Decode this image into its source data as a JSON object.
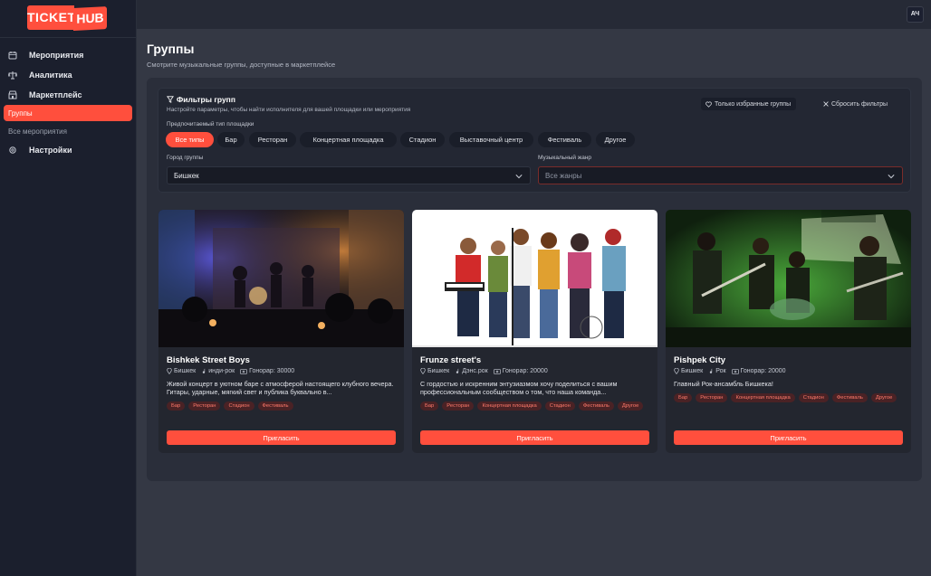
{
  "brand": {
    "logo_left": "TICKET",
    "logo_right": "HUB",
    "accent": "#ff4f3d"
  },
  "sidebar": {
    "items": [
      {
        "label": "Мероприятия",
        "icon": "calendar-icon"
      },
      {
        "label": "Аналитика",
        "icon": "scale-icon"
      },
      {
        "label": "Маркетплейс",
        "icon": "store-icon"
      },
      {
        "label": "Настройки",
        "icon": "gear-icon"
      }
    ],
    "subitems": [
      {
        "label": "Группы",
        "active": true
      },
      {
        "label": "Все мероприятия",
        "active": false
      }
    ]
  },
  "header": {
    "avatar": "АЧ"
  },
  "page": {
    "title": "Группы",
    "subtitle": "Смотрите музыкальные группы, доступные в маркетплейсе"
  },
  "filters": {
    "title": "Фильтры групп",
    "description": "Настройте параметры, чтобы найти исполнителя для вашей площадки или мероприятия",
    "favorites_label": "Только избранные группы",
    "reset_label": "Сбросить фильтры",
    "venue_type_label": "Предпочитаемый тип площадки",
    "venue_types": [
      "Все типы",
      "Бар",
      "Ресторан",
      "Концертная площадка",
      "Стадион",
      "Выставочный центр",
      "Фестиваль",
      "Другое"
    ],
    "active_venue_type": "Все типы",
    "city_label": "Город группы",
    "city_value": "Бишкек",
    "genre_label": "Музыкальный жанр",
    "genre_placeholder": "Все жанры"
  },
  "bands": [
    {
      "name": "Bishkek Street Boys",
      "city": "Бишкек",
      "genre": "инди-рок",
      "fee": "Гонорар: 30000",
      "description": "Живой концерт в уютном баре с атмосферой настоящего клубного вечера. Гитары, ударные, мягкий свет и публика буквально в...",
      "tags": [
        "Бар",
        "Ресторан",
        "Стадион",
        "Фестиваль"
      ],
      "invite_label": "Пригласить"
    },
    {
      "name": "Frunze street's",
      "city": "Бишкек",
      "genre": "Дэнс.рок",
      "fee": "Гонорар: 20000",
      "description": "С гордостью и искренним энтузиазмом хочу поделиться с вашим профессиональным сообществом о том, что наша команда...",
      "tags": [
        "Бар",
        "Ресторан",
        "Концертная площадка",
        "Стадион",
        "Фестиваль",
        "Другое"
      ],
      "invite_label": "Пригласить"
    },
    {
      "name": "Pishpek City",
      "city": "Бишкек",
      "genre": "Рок",
      "fee": "Гонорар: 20000",
      "description": "Главный Рок-ансамбль Бишкека!",
      "tags": [
        "Бар",
        "Ресторан",
        "Концертная площадка",
        "Стадион",
        "Фестиваль",
        "Другое"
      ],
      "invite_label": "Пригласить"
    }
  ]
}
